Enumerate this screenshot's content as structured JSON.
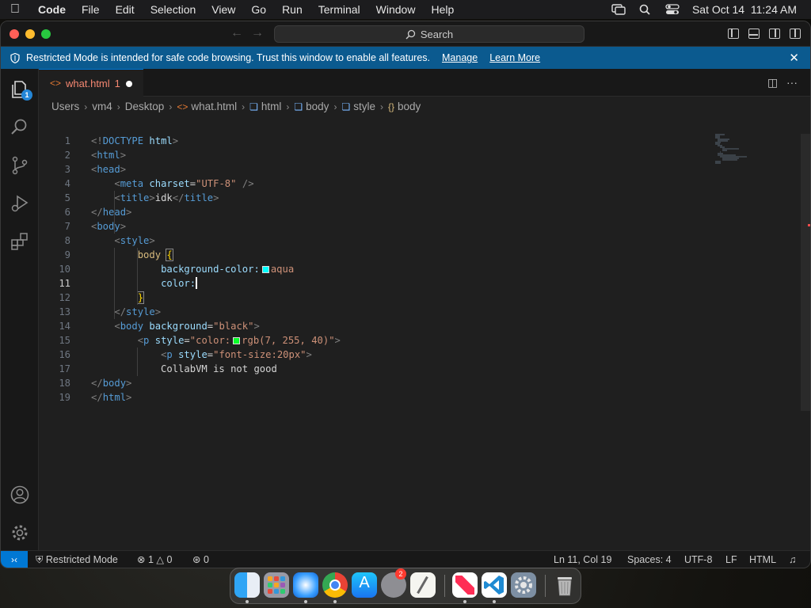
{
  "menubar": {
    "app_name": "Code",
    "items": [
      "File",
      "Edit",
      "Selection",
      "View",
      "Go",
      "Run",
      "Terminal",
      "Window",
      "Help"
    ],
    "clock": "Sat Oct 14  11:24 AM"
  },
  "titlebar": {
    "search_label": "Search"
  },
  "restricted_banner": {
    "message": "Restricted Mode is intended for safe code browsing. Trust this window to enable all features.",
    "manage_label": "Manage",
    "learn_more_label": "Learn More",
    "close_glyph": "✕"
  },
  "activity": {
    "explorer_badge": "1",
    "items": [
      "explorer-icon",
      "search-icon",
      "source-control-icon",
      "run-debug-icon",
      "extensions-icon",
      "accounts-icon",
      "gear-icon"
    ]
  },
  "tab": {
    "filename": "what.html",
    "problem_count": "1"
  },
  "breadcrumb": {
    "parts": [
      "Users",
      "vm4",
      "Desktop",
      "what.html",
      "html",
      "body",
      "style",
      "body"
    ]
  },
  "code": {
    "current_line": 11,
    "lines": [
      {
        "n": "1",
        "text": "<!DOCTYPE html>"
      },
      {
        "n": "2",
        "text": "<html>"
      },
      {
        "n": "3",
        "text": "<head>"
      },
      {
        "n": "4",
        "text": "    <meta charset=\"UTF-8\" />"
      },
      {
        "n": "5",
        "text": "    <title>idk</title>"
      },
      {
        "n": "6",
        "text": "</head>"
      },
      {
        "n": "7",
        "text": "<body>"
      },
      {
        "n": "8",
        "text": "    <style>"
      },
      {
        "n": "9",
        "text": "        body {"
      },
      {
        "n": "10",
        "text": "            background-color: aqua"
      },
      {
        "n": "11",
        "text": "            color:"
      },
      {
        "n": "12",
        "text": "        }"
      },
      {
        "n": "13",
        "text": "    </style>"
      },
      {
        "n": "14",
        "text": "    <body background=\"black\">"
      },
      {
        "n": "15",
        "text": "        <p style=\"color: rgb(7, 255, 40)\">"
      },
      {
        "n": "16",
        "text": "            <p style=\"font-size:20px\">"
      },
      {
        "n": "17",
        "text": "            CollabVM is not good"
      },
      {
        "n": "18",
        "text": "</body>"
      },
      {
        "n": "19",
        "text": "</html>"
      }
    ]
  },
  "statusbar": {
    "restricted_mode": "Restricted Mode",
    "errors": "1",
    "warnings": "0",
    "ports": "0",
    "position": "Ln 11, Col 19",
    "spaces": "Spaces: 4",
    "encoding": "UTF-8",
    "eol": "LF",
    "language": "HTML"
  },
  "dock": {
    "apps": [
      "finder-icon",
      "launchpad-icon",
      "safari-icon",
      "chrome-icon",
      "app-store-icon",
      "system-settings-icon",
      "textedit-icon",
      "news-icon",
      "vscode-icon",
      "preferences-icon",
      "trash-icon"
    ],
    "system_settings_badge": "2"
  },
  "colors": {
    "accent": "#0078d4",
    "banner": "#0b5a8f",
    "tab_error_text": "#f48771",
    "aqua_swatch": "#00ffff",
    "green_swatch": "#07ff28"
  }
}
